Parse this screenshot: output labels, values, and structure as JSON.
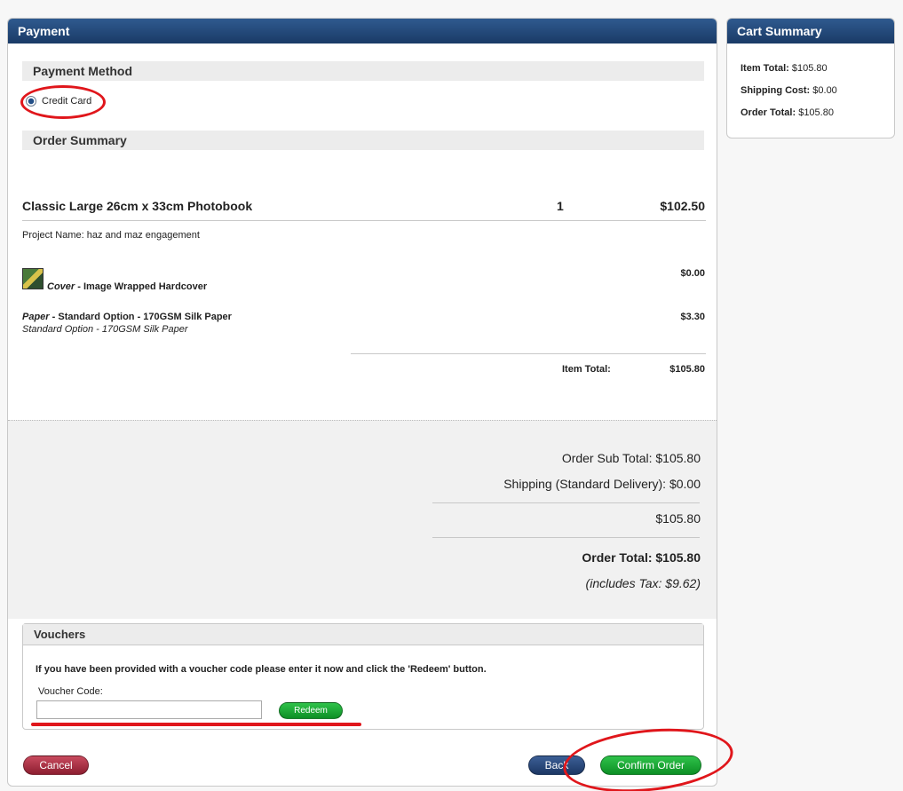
{
  "payment_panel": {
    "title": "Payment",
    "payment_method_heading": "Payment Method",
    "credit_card_label": "Credit Card",
    "order_summary_heading": "Order Summary"
  },
  "item": {
    "title": "Classic Large 26cm x 33cm Photobook",
    "quantity": "1",
    "price": "$102.50",
    "project_name": "Project Name: haz and maz engagement",
    "options": [
      {
        "label": "Cover",
        "value": " - Image Wrapped Hardcover",
        "sub": "",
        "price": "$0.00"
      },
      {
        "label": "Paper",
        "value": " - Standard Option - 170GSM Silk Paper",
        "sub": "Standard Option - 170GSM Silk Paper",
        "price": "$3.30"
      }
    ],
    "item_total_label": "Item Total:",
    "item_total_value": "$105.80"
  },
  "totals": {
    "sub_total": "Order Sub Total: $105.80",
    "shipping": "Shipping (Standard Delivery): $0.00",
    "amount": "$105.80",
    "order_total": "Order Total: $105.80",
    "tax": "(includes Tax: $9.62)"
  },
  "vouchers": {
    "heading": "Vouchers",
    "instructions": "If you have been provided with a voucher code please enter it now and click the 'Redeem' button.",
    "code_label": "Voucher Code:",
    "code_value": "",
    "redeem_label": "Redeem"
  },
  "actions": {
    "cancel_label": "Cancel",
    "back_label": "Back",
    "confirm_label": "Confirm Order"
  },
  "cart_summary": {
    "title": "Cart Summary",
    "item_total_label": "Item Total:",
    "item_total_value": " $105.80",
    "shipping_label": "Shipping Cost:",
    "shipping_value": " $0.00",
    "order_total_label": "Order Total:",
    "order_total_value": " $105.80"
  },
  "colors": {
    "header_blue": "#1a3a66",
    "confirm_green": "#0d8f25",
    "cancel_red": "#8d1e30",
    "annotation_red": "#e0161b"
  }
}
